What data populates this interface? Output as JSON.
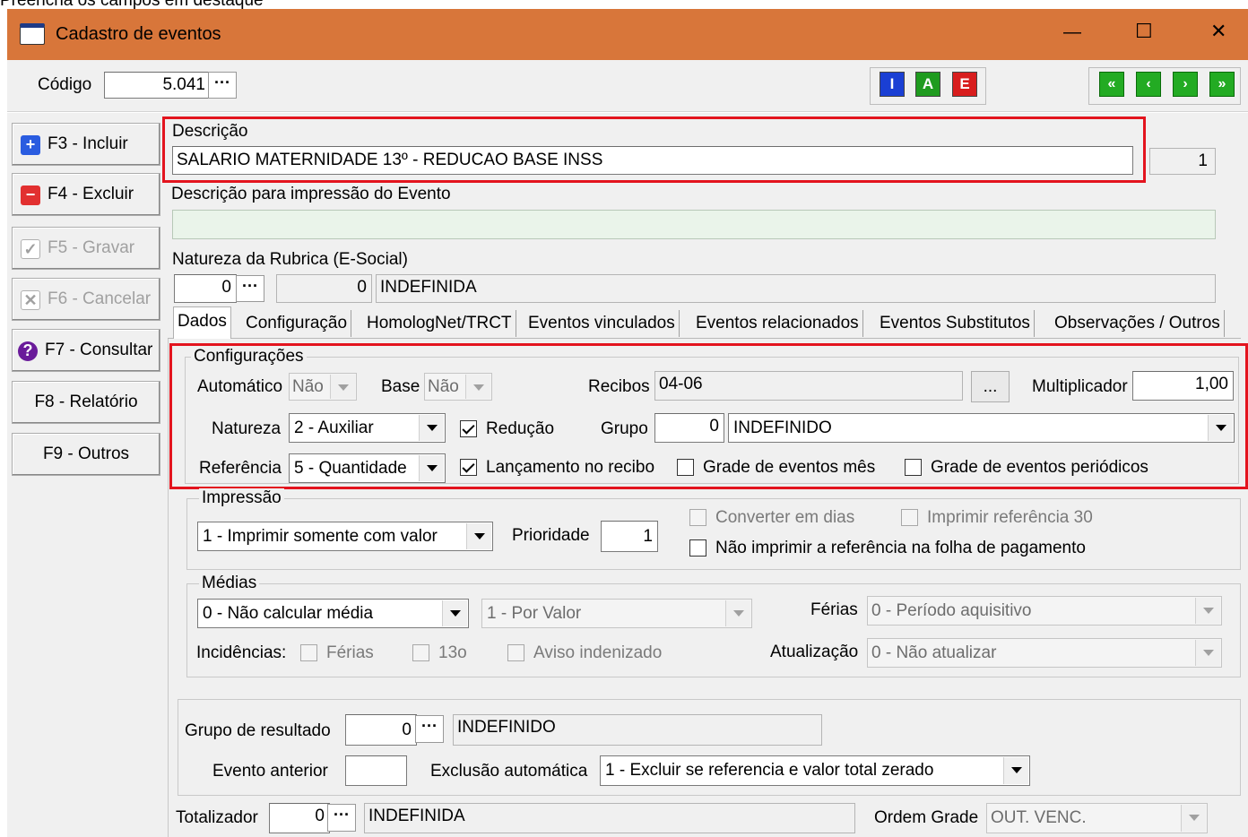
{
  "top_caption": "Preencha os campos em destaque",
  "window": {
    "title": "Cadastro de eventos",
    "minimize": "—",
    "maximize": "☐",
    "close": "✕"
  },
  "header": {
    "codigo_label": "Código",
    "codigo_value": "5.041",
    "dots": "···",
    "mode_buttons": [
      "I",
      "A",
      "E"
    ],
    "nav_buttons": [
      "«",
      "‹",
      "›",
      "»"
    ]
  },
  "sidebar": {
    "items": [
      {
        "label": "F3 - Incluir",
        "icon": "+"
      },
      {
        "label": "F4 - Excluir",
        "icon": "−"
      },
      {
        "label": "F5 - Gravar",
        "icon": "✓"
      },
      {
        "label": "F6 - Cancelar",
        "icon": "✕"
      },
      {
        "label": "F7 - Consultar",
        "icon": "?"
      },
      {
        "label": "F8 - Relatório"
      },
      {
        "label": "F9 - Outros"
      }
    ]
  },
  "descricao": {
    "label": "Descrição",
    "value": "SALARIO MATERNIDADE 13º - REDUCAO BASE INSS",
    "side_value": "1"
  },
  "descricao_impressao": {
    "label": "Descrição para impressão do Evento",
    "value": ""
  },
  "natureza_rubrica": {
    "label": "Natureza da Rubrica (E-Social)",
    "code": "0",
    "code2": "0",
    "name": "INDEFINIDA"
  },
  "tabs": [
    "Dados",
    "Configuração",
    "HomologNet/TRCT",
    "Eventos vinculados",
    "Eventos relacionados",
    "Eventos Substitutos",
    "Observações / Outros"
  ],
  "configuracoes": {
    "title": "Configurações",
    "automatico_label": "Automático",
    "automatico_value": "Não",
    "base_label": "Base",
    "base_value": "Não",
    "recibos_label": "Recibos",
    "recibos_value": "04-06",
    "recibos_btn": "...",
    "multiplicador_label": "Multiplicador",
    "multiplicador_value": "1,00",
    "natureza_label": "Natureza",
    "natureza_value": "2 - Auxiliar",
    "reducao_label": "Redução",
    "grupo_label": "Grupo",
    "grupo_code": "0",
    "grupo_value": "INDEFINIDO",
    "referencia_label": "Referência",
    "referencia_value": "5 - Quantidade",
    "lancamento_label": "Lançamento no recibo",
    "grade_mes_label": "Grade de eventos mês",
    "grade_periodicos_label": "Grade de eventos periódicos"
  },
  "impressao": {
    "title": "Impressão",
    "tipo_value": "1 - Imprimir somente com valor",
    "prioridade_label": "Prioridade",
    "prioridade_value": "1",
    "converter_label": "Converter em dias",
    "imprimir_ref30_label": "Imprimir referência 30",
    "nao_imprimir_label": "Não imprimir a referência na folha de pagamento"
  },
  "medias": {
    "title": "Médias",
    "calc_value": "0 - Não calcular média",
    "por_value": "1 - Por Valor",
    "ferias_label": "Férias",
    "ferias_value": "0 - Período aquisitivo",
    "incidencias_label": "Incidências:",
    "inc_ferias": "Férias",
    "inc_13o": "13o",
    "inc_aviso": "Aviso indenizado",
    "atualizacao_label": "Atualização",
    "atualizacao_value": "0 - Não atualizar"
  },
  "resultado": {
    "grupo_label": "Grupo de resultado",
    "grupo_code": "0",
    "grupo_value": "INDEFINIDO",
    "evento_anterior_label": "Evento anterior",
    "evento_anterior_value": "",
    "exclusao_label": "Exclusão automática",
    "exclusao_value": "1 - Excluir se referencia e valor total zerado"
  },
  "footer": {
    "totalizador_label": "Totalizador",
    "totalizador_code": "0",
    "totalizador_value": "INDEFINIDA",
    "ordem_label": "Ordem Grade",
    "ordem_value": "OUT. VENC."
  }
}
